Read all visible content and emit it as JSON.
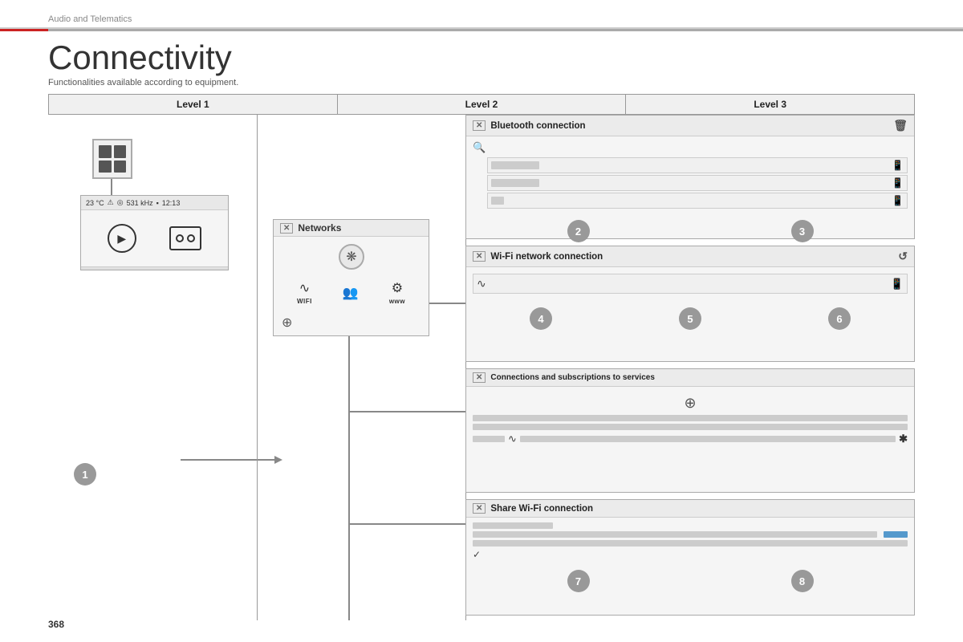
{
  "header": {
    "breadcrumb": "Audio and Telematics",
    "title": "Connectivity",
    "subtitle": "Functionalities available according to equipment."
  },
  "table": {
    "col1": "Level 1",
    "col2": "Level 2",
    "col3": "Level 3"
  },
  "level1": {
    "home_icon_label": "Home screen"
  },
  "level2": {
    "networks_title": "Networks",
    "networks_bt_symbol": "⊛",
    "wifi_label": "WIFI",
    "group_label": "",
    "www_label": "www",
    "globe_symbol": "⊕"
  },
  "level3": {
    "bt_panel": {
      "title": "Bluetooth connection",
      "trash_icon": "🗑",
      "search_icon": "🔍"
    },
    "wifi_panel": {
      "title": "Wi-Fi network connection",
      "refresh_icon": "↺"
    },
    "conn_panel": {
      "title": "Connections and subscriptions to services",
      "globe_symbol": "⊕"
    },
    "share_panel": {
      "title": "Share Wi-Fi connection"
    }
  },
  "badges": {
    "b1": "1",
    "b2": "2",
    "b3": "3",
    "b4": "4",
    "b5": "5",
    "b6": "6",
    "b7": "7",
    "b8": "8"
  },
  "page_number": "368",
  "device": {
    "status": "23 °C",
    "warning": "⚠",
    "radio_icon": "◎",
    "frequency": "531 kHz",
    "time": "12:13"
  }
}
